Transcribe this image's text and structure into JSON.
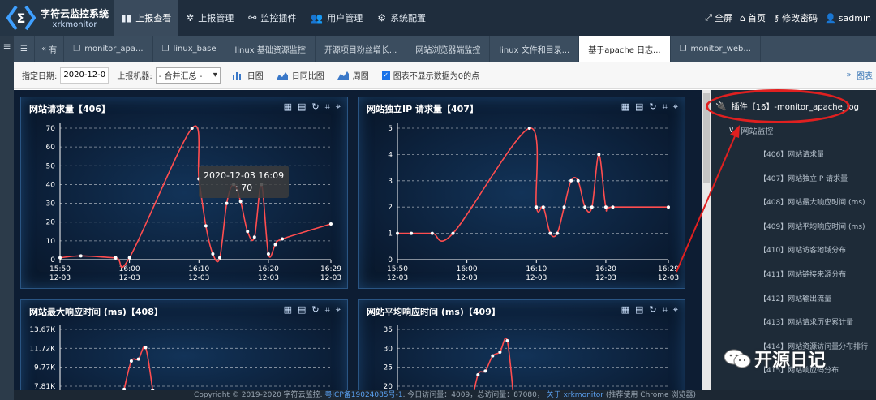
{
  "app": {
    "title": "字符云监控系统",
    "subtitle": "xrkmonitor"
  },
  "nav": {
    "items": [
      {
        "label": "上报查看",
        "icon": "bar-chart-icon",
        "active": true
      },
      {
        "label": "上报管理",
        "icon": "cog-icon",
        "active": false
      },
      {
        "label": "监控插件",
        "icon": "plug-icon",
        "active": false
      },
      {
        "label": "用户管理",
        "icon": "users-icon",
        "active": false
      },
      {
        "label": "系统配置",
        "icon": "gear-icon",
        "active": false
      }
    ],
    "right": [
      {
        "label": "全屏",
        "icon": "fullscreen-icon"
      },
      {
        "label": "首页",
        "icon": "home-icon"
      },
      {
        "label": "修改密码",
        "icon": "key-icon"
      },
      {
        "label": "sadmin",
        "icon": "user-icon"
      }
    ]
  },
  "tabs": [
    {
      "label": "monitor_apa...",
      "icon": "window-icon"
    },
    {
      "label": "linux_base",
      "icon": "window-icon"
    },
    {
      "label": "linux 基础资源监控",
      "icon": ""
    },
    {
      "label": "开源项目粉丝增长...",
      "icon": ""
    },
    {
      "label": "网站浏览器端监控",
      "icon": ""
    },
    {
      "label": "linux 文件和目录...",
      "icon": ""
    },
    {
      "label": "基于apache 日志...",
      "icon": ""
    },
    {
      "label": "monitor_web...",
      "icon": "window-icon"
    }
  ],
  "tab_partial": "有",
  "toolbar": {
    "date_label": "指定日期:",
    "date_value": "2020-12-03",
    "machine_label": "上报机器:",
    "machine_value": "- 合并汇总 -",
    "btn_day": "日图",
    "btn_daycompare": "日同比图",
    "btn_week": "周图",
    "check_label": "图表不显示数据为0的点",
    "right_label": "图表"
  },
  "charts": [
    {
      "title": "网站请求量【406】",
      "chart_data": {
        "type": "line",
        "x": [
          "15:50",
          "15:53",
          "15:58",
          "16:00",
          "16:09",
          "16:10",
          "16:11",
          "16:12",
          "16:13",
          "16:14",
          "16:15",
          "16:16",
          "16:17",
          "16:18",
          "16:19",
          "16:20",
          "16:21",
          "16:22",
          "16:29"
        ],
        "values": [
          1,
          2,
          1,
          1,
          70,
          43,
          18,
          3,
          1,
          30,
          40,
          31,
          15,
          12,
          40,
          3,
          8,
          11,
          19
        ],
        "xticks": [
          "15:50",
          "16:00",
          "16:10",
          "16:20",
          "16:29"
        ],
        "xtick_sub": "12-03",
        "ylim": [
          0,
          70
        ],
        "yticks": [
          0,
          10,
          20,
          30,
          40,
          50,
          60,
          70
        ]
      },
      "tooltip": {
        "time": "2020-12-03 16:09",
        "value": ": 70"
      }
    },
    {
      "title": "网站独立IP 请求量【407】",
      "chart_data": {
        "type": "line",
        "x": [
          "15:50",
          "15:52",
          "15:55",
          "15:58",
          "16:09",
          "16:10",
          "16:11",
          "16:12",
          "16:13",
          "16:14",
          "16:15",
          "16:16",
          "16:17",
          "16:18",
          "16:19",
          "16:20",
          "16:21",
          "16:29"
        ],
        "values": [
          1,
          1,
          1,
          1,
          5,
          2,
          2,
          1,
          1,
          2,
          3,
          3,
          2,
          2,
          4,
          2,
          2,
          2
        ],
        "xticks": [
          "15:50",
          "16:00",
          "16:10",
          "16:20",
          "16:29"
        ],
        "xtick_sub": "12-03",
        "ylim": [
          0,
          5
        ],
        "yticks": [
          0,
          1,
          2,
          3,
          4,
          5
        ]
      }
    },
    {
      "title": "网站最大响应时间 (ms)【408】",
      "chart_data": {
        "type": "line",
        "x": [
          "16:09",
          "16:10",
          "16:11",
          "16:12",
          "16:13"
        ],
        "values": [
          7500,
          10400,
          10600,
          11800,
          7400
        ],
        "yticks_labels": [
          "13.67K",
          "11.72K",
          "9.77K",
          "7.81K"
        ],
        "yticks": [
          13670,
          11720,
          9770,
          7810
        ]
      }
    },
    {
      "title": "网站平均响应时间 (ms)【409】",
      "chart_data": {
        "type": "line",
        "x": [
          "16:08",
          "16:09",
          "16:10",
          "16:11",
          "16:12",
          "16:13",
          "16:14"
        ],
        "values": [
          14,
          23,
          24,
          28,
          29,
          32,
          14
        ],
        "yticks_labels": [
          "35",
          "30",
          "25",
          "20"
        ],
        "yticks": [
          35,
          30,
          25,
          20
        ]
      }
    }
  ],
  "tree": {
    "plugin": "插件【16】-monitor_apache_log",
    "group": "网站监控",
    "items": [
      "【406】网站请求量",
      "【407】网站独立IP 请求量",
      "【408】网站最大响应时间 (ms)",
      "【409】网站平均响应时间 (ms)",
      "【410】网站访客地域分布",
      "【411】网站链接来源分布",
      "【412】网站输出流量",
      "【413】网站请求历史累计量",
      "【414】网站资源访问量分布排行",
      "【415】网站响应码分布"
    ]
  },
  "footer": {
    "text1": "Copyright © 2019-2020 字符云监控.",
    "icp": "粤ICP备19024085号-1",
    "text2": ". 今日访问量：4009，总访问量：87080，",
    "about": "关于 xrkmonitor",
    "text3": "(推荐使用 Chrome 浏览器)"
  },
  "watermark": "开源日记",
  "colors": {
    "line": "#ff4d4f",
    "dash_bg": "#0d1d33",
    "tree_bg": "#1e2b38",
    "annotation": "#e02020"
  }
}
